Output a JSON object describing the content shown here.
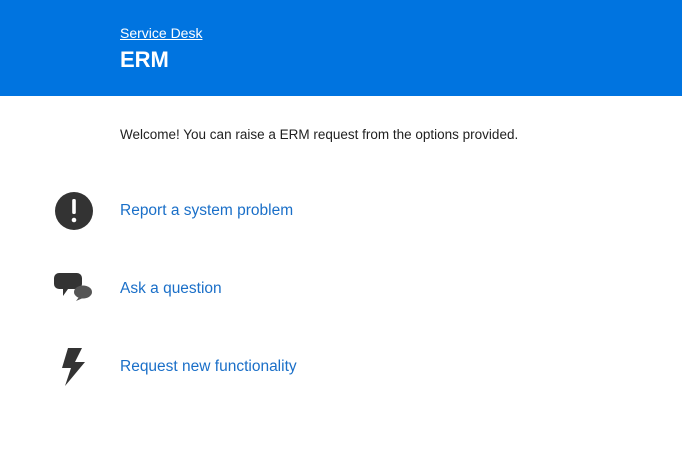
{
  "header": {
    "breadcrumb": "Service Desk",
    "title": "ERM",
    "background_color": "#0074e0"
  },
  "welcome_text": "Welcome! You can raise a ERM request from the options provided.",
  "options": [
    {
      "label": "Report a system problem",
      "icon": "exclamation-icon"
    },
    {
      "label": "Ask a question",
      "icon": "chat-bubbles-icon"
    },
    {
      "label": "Request new functionality",
      "icon": "lightning-bolt-icon"
    }
  ],
  "colors": {
    "link": "#1a6fc8",
    "icon": "#333333"
  }
}
